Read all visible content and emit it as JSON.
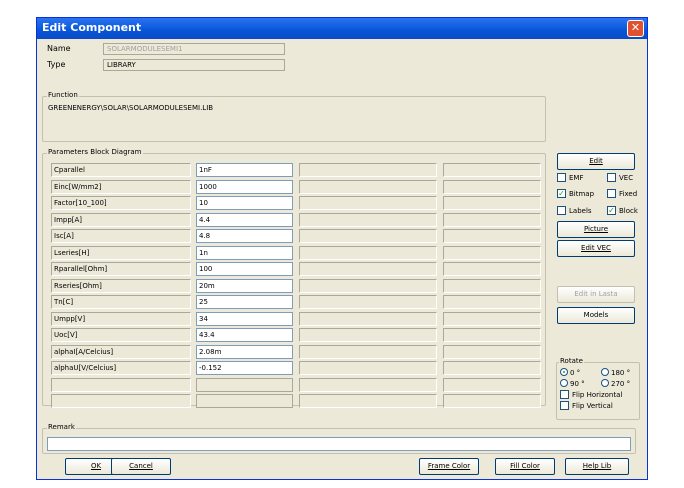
{
  "window": {
    "title": "Edit Component",
    "close_glyph": "✕"
  },
  "header": {
    "name_label": "Name",
    "name_value": "SOLARMODULESEMI1",
    "type_label": "Type",
    "type_value": "LIBRARY"
  },
  "function": {
    "label": "Function",
    "value": "GREENENERGY\\SOLAR\\SOLARMODULESEMI.LIB"
  },
  "parameters": {
    "label": "Parameters Block Diagram",
    "rows": [
      {
        "name": "Cparallel",
        "value": "1nF"
      },
      {
        "name": "Einc[W/mm2]",
        "value": "1000"
      },
      {
        "name": "Factor[10_100]",
        "value": "10"
      },
      {
        "name": "Impp[A]",
        "value": "4.4"
      },
      {
        "name": "Isc[A]",
        "value": "4.8"
      },
      {
        "name": "Lseries[H]",
        "value": "1n"
      },
      {
        "name": "Rparallel[Ohm]",
        "value": "100"
      },
      {
        "name": "Rseries[Ohm]",
        "value": "20m"
      },
      {
        "name": "Tn[C]",
        "value": "25"
      },
      {
        "name": "Umpp[V]",
        "value": "34"
      },
      {
        "name": "Uoc[V]",
        "value": "43.4"
      },
      {
        "name": "alphaI[A/Celcius]",
        "value": "2.08m"
      },
      {
        "name": "alphaU[V/Celcius]",
        "value": "-0.152"
      },
      {
        "name": "",
        "value": ""
      },
      {
        "name": "",
        "value": ""
      }
    ]
  },
  "side": {
    "edit_button": "Edit",
    "checkboxes": {
      "emf": {
        "label": "EMF",
        "checked": false
      },
      "vec": {
        "label": "VEC",
        "checked": false
      },
      "bitmap": {
        "label": "Bitmap",
        "checked": true
      },
      "fixed": {
        "label": "Fixed",
        "checked": false
      },
      "labels": {
        "label": "Labels",
        "checked": false
      },
      "block": {
        "label": "Block",
        "checked": true
      }
    },
    "picture_button": "Picture",
    "edit_vec_button": "Edit VEC",
    "edit_in_lasta_button": "Edit in Lasta",
    "models_button": "Models",
    "rotate": {
      "label": "Rotate",
      "options": [
        "0 °",
        "180 °",
        "90 °",
        "270 °"
      ],
      "selected": "0 °",
      "flip_horizontal": "Flip Horizontal",
      "flip_vertical": "Flip Vertical"
    }
  },
  "remark": {
    "label": "Remark",
    "value": ""
  },
  "footer": {
    "ok": "OK",
    "cancel": "Cancel",
    "frame_color": "Frame Color",
    "fill_color": "Fill Color",
    "help_lib": "Help Lib"
  },
  "icons": {
    "check_glyph": "✓",
    "check_color": "#21a121"
  }
}
